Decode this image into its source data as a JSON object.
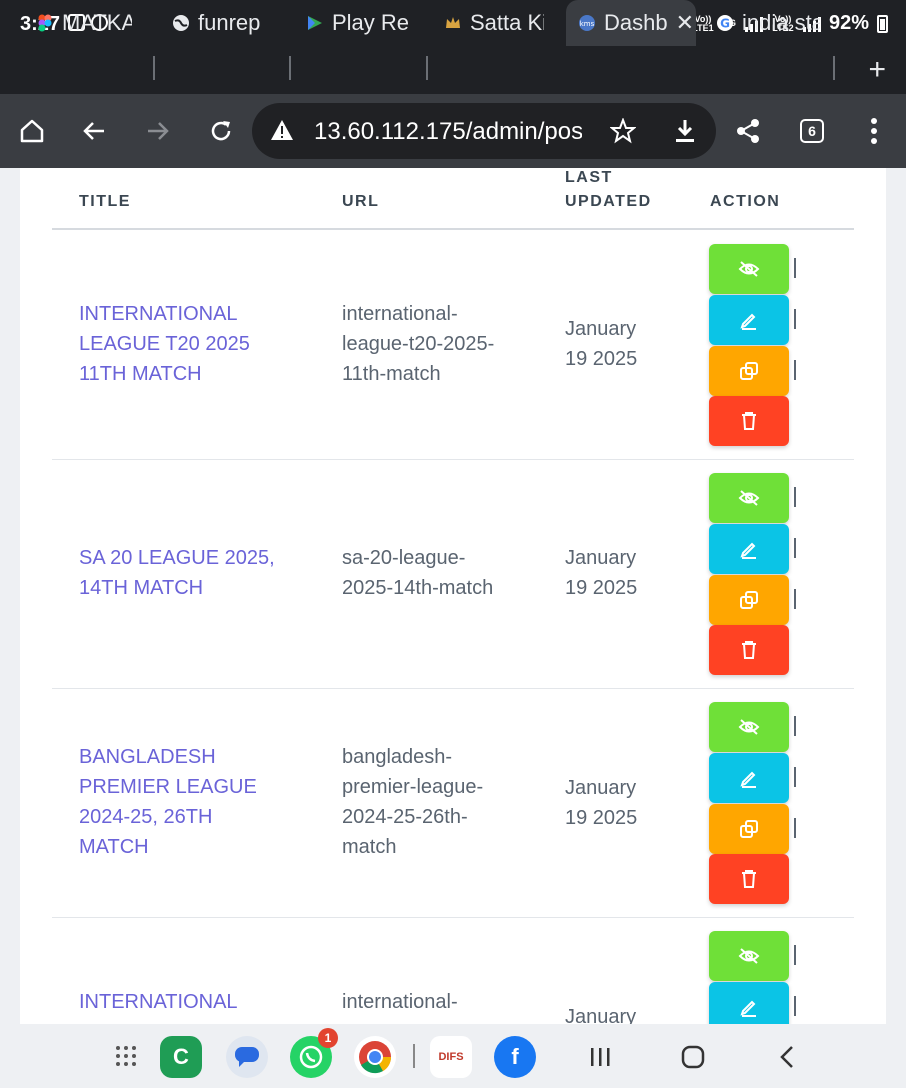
{
  "status_bar": {
    "time": "3:27",
    "net_label_1": "Vo)) LTE1",
    "net_label_2": "4G",
    "net_label_3": "Vo)) LTE2",
    "battery": "92%"
  },
  "tabs": [
    {
      "label": "MATKA",
      "favicon": "figma-icon"
    },
    {
      "label": "funrep",
      "favicon": "globe-icon"
    },
    {
      "label": "Play Re",
      "favicon": "play-icon"
    },
    {
      "label": "Satta Ki",
      "favicon": "crown-icon"
    },
    {
      "label": "Dashb",
      "favicon": "dashboard-icon",
      "active": true
    },
    {
      "label": "india sta",
      "favicon": "google-icon"
    }
  ],
  "toolbar": {
    "url": "13.60.112.175/admin/post",
    "tab_count": "6"
  },
  "table": {
    "headers": {
      "title": "TITLE",
      "url": "URL",
      "last_updated_1": "LAST",
      "last_updated_2": "UPDATED",
      "action": "ACTION"
    },
    "rows": [
      {
        "title_lines": [
          "INTERNATIONAL",
          "LEAGUE T20 2025",
          "11TH MATCH"
        ],
        "url_lines": [
          "international-",
          "league-t20-2025-",
          "11th-match"
        ],
        "date_lines": [
          "January",
          "19 2025"
        ]
      },
      {
        "title_lines": [
          "SA 20 LEAGUE 2025,",
          "14TH MATCH"
        ],
        "url_lines": [
          "sa-20-league-",
          "2025-14th-match"
        ],
        "date_lines": [
          "January",
          "19 2025"
        ]
      },
      {
        "title_lines": [
          "BANGLADESH",
          "PREMIER LEAGUE",
          "2024-25, 26TH",
          "MATCH"
        ],
        "url_lines": [
          "bangladesh-",
          "premier-league-",
          "2024-25-26th-",
          "match"
        ],
        "date_lines": [
          "January",
          "19 2025"
        ]
      },
      {
        "title_lines": [
          "INTERNATIONAL"
        ],
        "url_lines": [
          "international-"
        ],
        "date_lines": [
          "January"
        ]
      }
    ]
  },
  "colors": {
    "view": "#6fe038",
    "edit": "#0bc4e6",
    "duplicate": "#ffa600",
    "delete": "#ff4223",
    "title_link": "#6a63d8"
  },
  "dock": {
    "whatsapp_badge": "1",
    "difs_label": "DIFS"
  }
}
